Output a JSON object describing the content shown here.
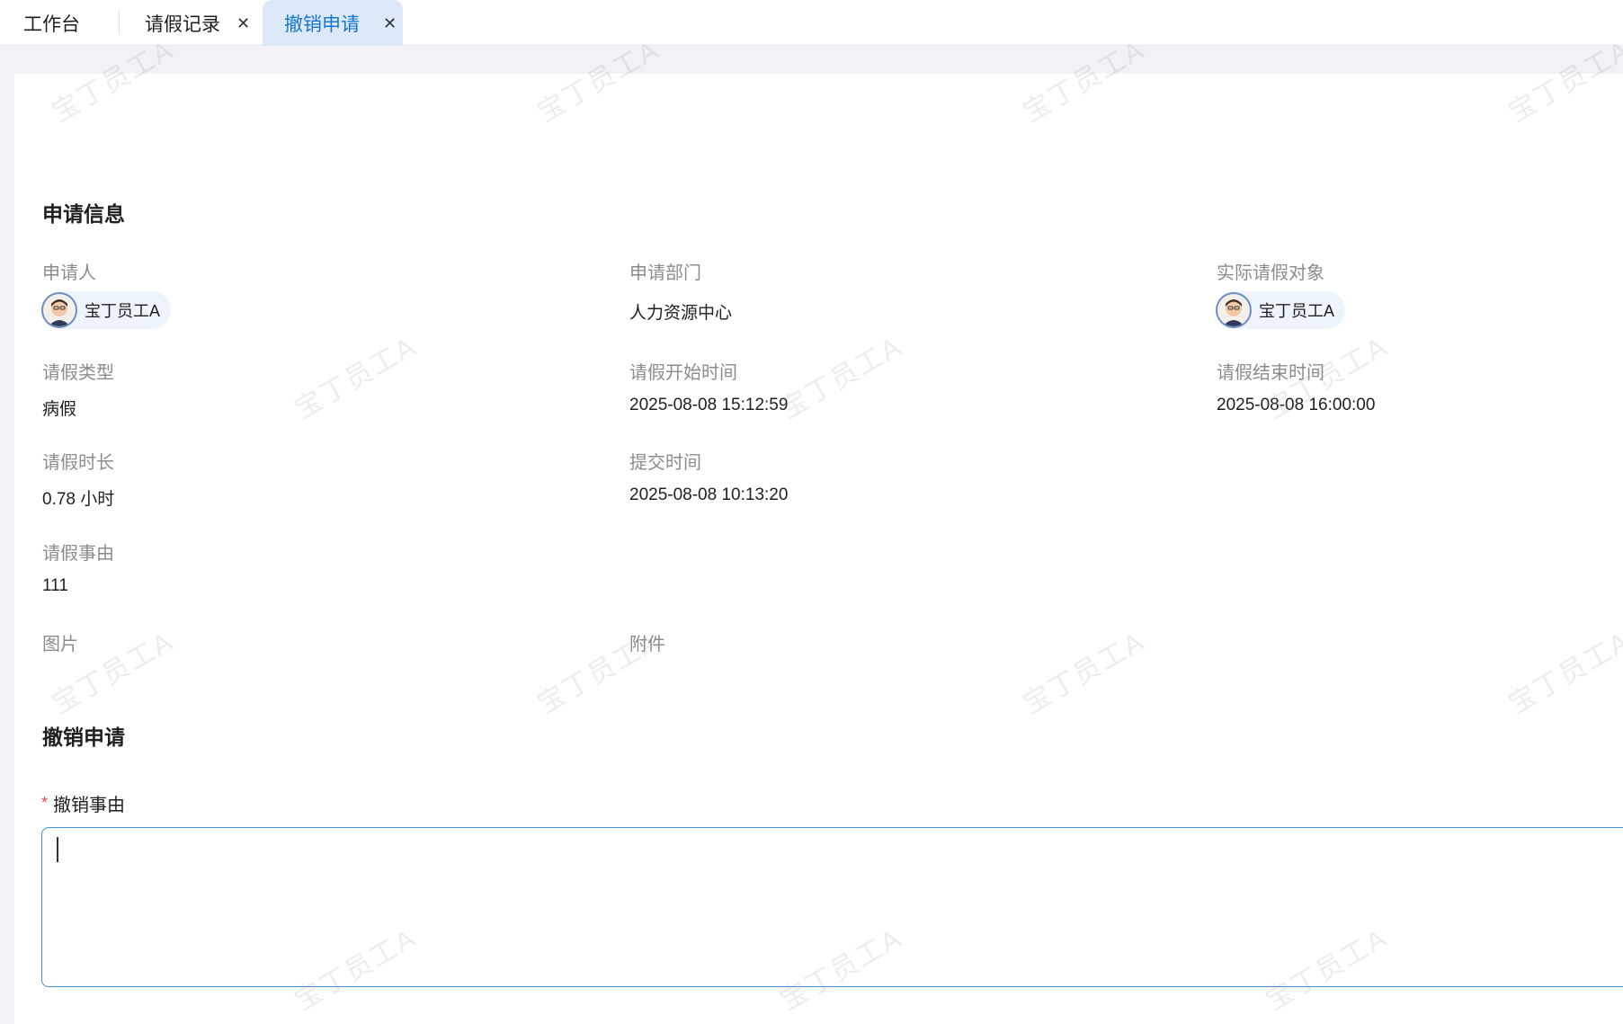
{
  "tabs": [
    {
      "label": "工作台",
      "closable": false,
      "active": false
    },
    {
      "label": "请假记录",
      "closable": true,
      "active": false
    },
    {
      "label": "撤销申请",
      "closable": true,
      "active": true
    }
  ],
  "application_info": {
    "title": "申请信息",
    "applicant_label": "申请人",
    "applicant_name": "宝丁员工A",
    "department_label": "申请部门",
    "department_value": "人力资源中心",
    "actual_target_label": "实际请假对象",
    "actual_target_name": "宝丁员工A",
    "leave_type_label": "请假类型",
    "leave_type_value": "病假",
    "start_time_label": "请假开始时间",
    "start_time_value": "2025-08-08 15:12:59",
    "end_time_label": "请假结束时间",
    "end_time_value": "2025-08-08 16:00:00",
    "duration_label": "请假时长",
    "duration_value": "0.78 小时",
    "submit_time_label": "提交时间",
    "submit_time_value": "2025-08-08 10:13:20",
    "reason_label": "请假事由",
    "reason_value": "111",
    "images_label": "图片",
    "attachments_label": "附件"
  },
  "revoke": {
    "title": "撤销申请",
    "reason_label": "撤销事由",
    "required_mark": "*",
    "reason_value": ""
  },
  "watermark_text": "宝丁员工A",
  "colors": {
    "accent": "#1677d2",
    "active_tab_bg": "#dde9f8",
    "required": "#e5484d",
    "input_border": "#3f8fe0"
  }
}
